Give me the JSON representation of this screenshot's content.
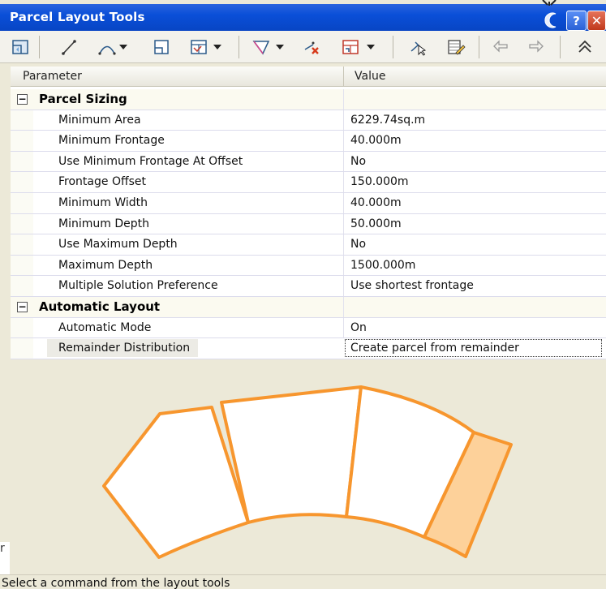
{
  "window": {
    "title": "Parcel Layout Tools",
    "help_label": "?",
    "close_label": "✕"
  },
  "toolbar": {
    "tools": [
      "create-parcel-icon",
      "slide-line-create-icon",
      "swing-line-create-icon",
      "free-form-create-icon",
      "parcel-edit-icon",
      "pi-edit-icon",
      "delete-subentity-icon",
      "parcel-union-icon",
      "pick-subentity-icon",
      "subentity-editor-icon",
      "undo-icon",
      "redo-icon",
      "collapse-icon"
    ]
  },
  "grid": {
    "header": {
      "parameter": "Parameter",
      "value": "Value"
    },
    "categories": [
      {
        "label": "Parcel Sizing",
        "toggle": "−",
        "rows": [
          {
            "param": "Minimum Area",
            "value": "6229.74sq.m"
          },
          {
            "param": "Minimum Frontage",
            "value": "40.000m"
          },
          {
            "param": "Use Minimum Frontage At Offset",
            "value": "No"
          },
          {
            "param": "Frontage Offset",
            "value": "150.000m"
          },
          {
            "param": "Minimum Width",
            "value": "40.000m"
          },
          {
            "param": "Minimum Depth",
            "value": "50.000m"
          },
          {
            "param": "Use Maximum Depth",
            "value": "No"
          },
          {
            "param": "Maximum Depth",
            "value": "1500.000m"
          },
          {
            "param": "Multiple Solution Preference",
            "value": "Use shortest frontage"
          }
        ]
      },
      {
        "label": "Automatic Layout",
        "toggle": "−",
        "rows": [
          {
            "param": "Automatic Mode",
            "value": "On"
          },
          {
            "param": "Remainder Distribution",
            "value": "Create parcel from remainder"
          }
        ]
      }
    ]
  },
  "diagram": {
    "stroke_color": "#f7962e",
    "remainder_fill": "#fdd19a",
    "parcel_fill": "#ffffff"
  },
  "status": {
    "text": "Select a command from the layout tools",
    "side_glyph": "r"
  }
}
